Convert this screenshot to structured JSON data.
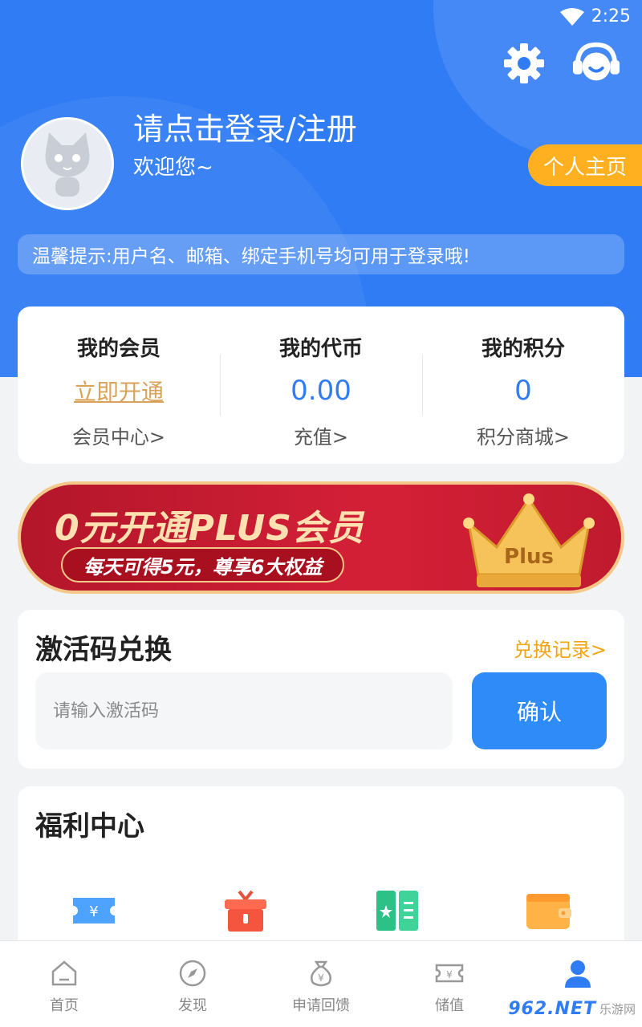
{
  "status_bar": {
    "time": "2:25"
  },
  "profile": {
    "login_title": "请点击登录/注册",
    "welcome": "欢迎您~",
    "homepage_button": "个人主页",
    "tip": "温馨提示:用户名、邮箱、绑定手机号均可用于登录哦!"
  },
  "stats": [
    {
      "title": "我的会员",
      "value": "立即开通",
      "sub": "会员中心>"
    },
    {
      "title": "我的代币",
      "value": "0.00",
      "sub": "充值>"
    },
    {
      "title": "我的积分",
      "value": "0",
      "sub": "积分商城>"
    }
  ],
  "banner": {
    "title": "0元开通PLUS会员",
    "subtitle": "每天可得5元，尊享6大权益",
    "crown_text": "Plus"
  },
  "redeem": {
    "title": "激活码兑换",
    "record_link": "兑换记录>",
    "placeholder": "请输入激活码",
    "confirm": "确认"
  },
  "welfare": {
    "title": "福利中心",
    "icons": [
      "coupon-icon",
      "gift-icon",
      "book-icon",
      "wallet-icon"
    ]
  },
  "nav": [
    {
      "label": "首页",
      "icon": "home-icon"
    },
    {
      "label": "发现",
      "icon": "compass-icon"
    },
    {
      "label": "申请回馈",
      "icon": "money-bag-icon"
    },
    {
      "label": "储值",
      "icon": "ticket-icon"
    },
    {
      "label": "",
      "icon": "user-icon",
      "active": true
    }
  ],
  "watermark": {
    "brand": "962.NET",
    "sub": "乐游网"
  },
  "colors": {
    "primary": "#2f7cf4",
    "accent": "#ffb020",
    "banner_red": "#c01a2e",
    "link_gold": "#d9a35a"
  }
}
